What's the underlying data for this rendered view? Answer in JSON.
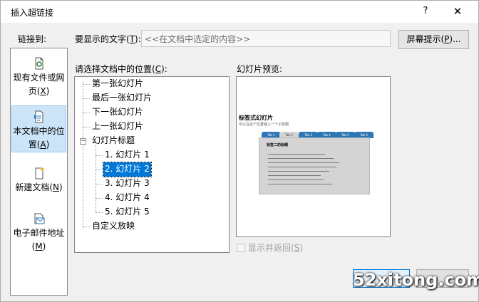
{
  "title": "插入超链接",
  "help": "?",
  "close": "✕",
  "link_to": {
    "label_prefix": "链接到",
    "label_suffix": ":",
    "items": [
      {
        "line1": "现有文件或网",
        "line2_pre": "页(",
        "key": "X",
        "line2_post": ")",
        "icon": "file-icon"
      },
      {
        "line1": "本文档中的位",
        "line2_pre": "置(",
        "key": "A",
        "line2_post": ")",
        "icon": "document-place-icon"
      },
      {
        "line1": "新建文档(",
        "key": "N",
        "line2_post": ")",
        "icon": "new-document-icon"
      },
      {
        "line1": "电子邮件地址",
        "line2_pre": "(",
        "key": "M",
        "line2_post": ")",
        "icon": "email-icon"
      }
    ]
  },
  "display_text": {
    "label_pre": "要显示的文字(",
    "label_key": "T",
    "label_post": "):",
    "value": "<<在文档中选定的内容>>"
  },
  "screentip": {
    "pre": "屏幕提示(",
    "key": "P",
    "post": ")..."
  },
  "place": {
    "label_pre": "请选择文档中的位置(",
    "label_key": "C",
    "label_post": "):",
    "items": [
      "第一张幻灯片",
      "最后一张幻灯片",
      "下一张幻灯片",
      "上一张幻灯片",
      "幻灯片标题",
      "1. 幻灯片 1",
      "2. 幻灯片 2",
      "3. 幻灯片 3",
      "4. 幻灯片 4",
      "5. 幻灯片 5",
      "自定义放映"
    ],
    "expander": "−"
  },
  "preview": {
    "label": "幻灯片预览:",
    "slide_title": "标签式幻灯片",
    "slide_subtitle": "可以在这个位置输入一个子标题",
    "tabs": [
      "Tab 1",
      "Tab 2",
      "Tab 3",
      "Tab 4",
      "Tab 5",
      "Tab 6"
    ],
    "panel_heading": "标签二的标题"
  },
  "show_return": {
    "pre": "显示并返回(",
    "key": "S",
    "post": ")"
  },
  "watermark": "52xitong.com"
}
